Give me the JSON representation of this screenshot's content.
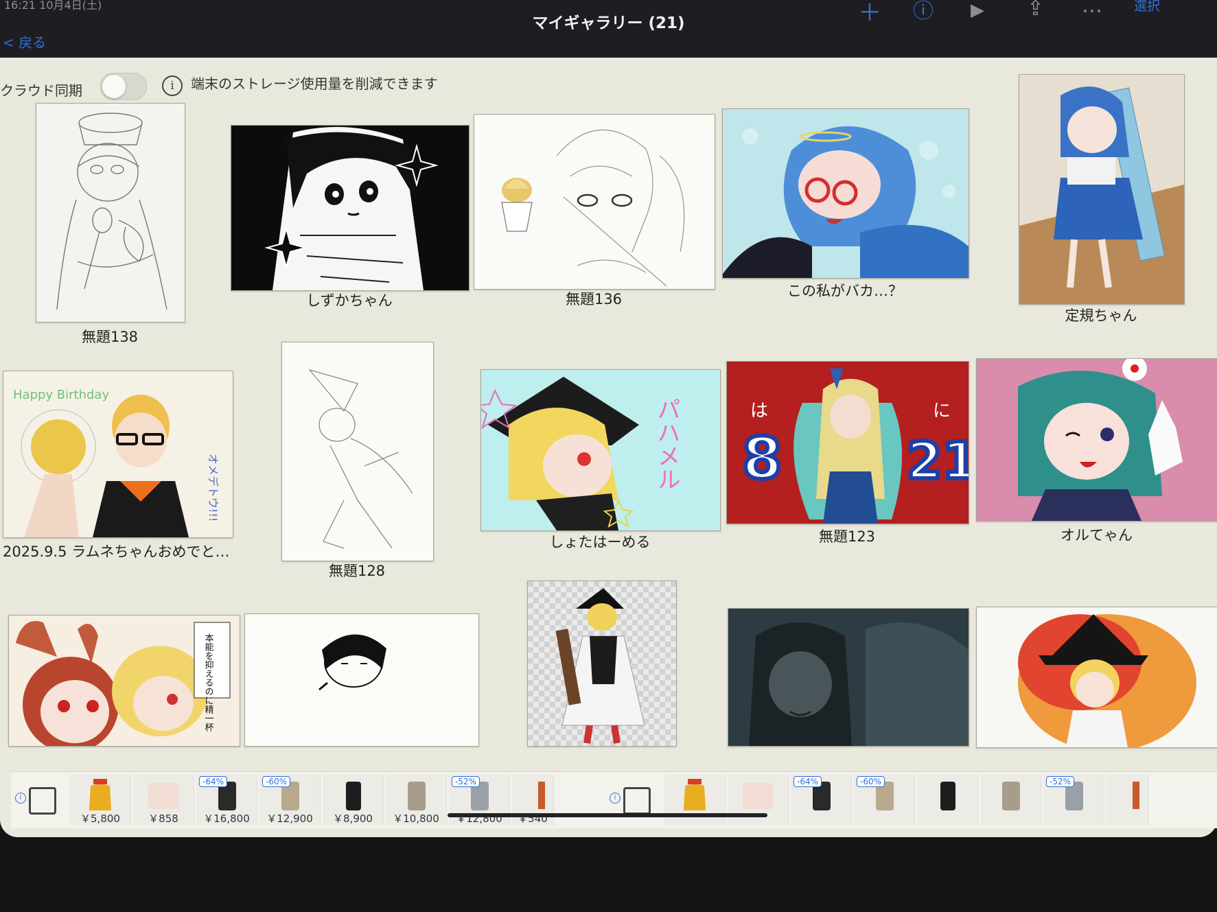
{
  "status": {
    "time": "16:21  10月4日(土)"
  },
  "nav": {
    "back_label": "< 戻る",
    "title": "マイギャラリー (21)",
    "select_label": "選択"
  },
  "cloud": {
    "label": "クラウド同期",
    "note": "端末のストレージ使用量を削減できます",
    "sync_enabled": false
  },
  "gallery": {
    "items": [
      {
        "caption": "無題138"
      },
      {
        "caption": "しずかちゃん"
      },
      {
        "caption": "無題136"
      },
      {
        "caption": "この私がバカ…？"
      },
      {
        "caption": "定規ちゃん"
      },
      {
        "caption": "2025.9.5 ラムネちゃんおめでと…"
      },
      {
        "caption": "無題128"
      },
      {
        "caption": "しょたはーめる"
      },
      {
        "caption": "無題123"
      },
      {
        "caption": "オルてゃん"
      },
      {
        "caption": ""
      },
      {
        "caption": ""
      },
      {
        "caption": ""
      },
      {
        "caption": ""
      },
      {
        "caption": ""
      }
    ]
  },
  "artwork_text": {
    "happy_birthday": "Happy Birthday",
    "omedetou": "オメデトウ!!!",
    "pa_ha_meru": "パハメル",
    "num8": "8",
    "num21": "21",
    "ha": "は",
    "ni": "に",
    "manga": "本能を抑えるのに精一杯"
  },
  "shop": {
    "products": [
      {
        "price": "￥5,800",
        "discount": ""
      },
      {
        "price": "￥858",
        "discount": ""
      },
      {
        "price": "￥16,800",
        "discount": "-64%"
      },
      {
        "price": "￥12,900",
        "discount": "-60%"
      },
      {
        "price": "￥8,900",
        "discount": ""
      },
      {
        "price": "￥10,800",
        "discount": ""
      },
      {
        "price": "￥12,800",
        "discount": "-52%"
      },
      {
        "price": "￥540",
        "discount": ""
      },
      {
        "price": "",
        "discount": ""
      },
      {
        "price": "",
        "discount": ""
      },
      {
        "price": "",
        "discount": "-64%"
      },
      {
        "price": "",
        "discount": "-60%"
      },
      {
        "price": "",
        "discount": ""
      },
      {
        "price": "",
        "discount": ""
      },
      {
        "price": "",
        "discount": "-52%"
      },
      {
        "price": "",
        "discount": ""
      }
    ]
  },
  "colors": {
    "accent": "#2f6fd8",
    "background": "#e9e8dc",
    "topbar": "#1e1e22"
  }
}
